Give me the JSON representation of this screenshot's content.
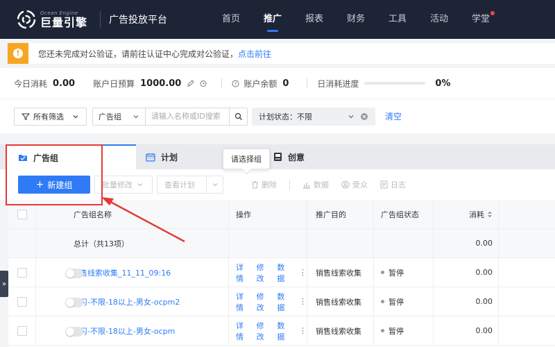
{
  "topnav": {
    "logo_en": "Ocean Engine",
    "logo_cn": "巨量引擎",
    "platform": "广告投放平台",
    "items": [
      {
        "label": "首页",
        "active": false
      },
      {
        "label": "推广",
        "active": true
      },
      {
        "label": "报表",
        "active": false
      },
      {
        "label": "财务",
        "active": false
      },
      {
        "label": "工具",
        "active": false
      },
      {
        "label": "活动",
        "active": false
      },
      {
        "label": "学堂",
        "active": false,
        "dot": true
      }
    ]
  },
  "alert": {
    "text": "您还未完成对公验证，请前往认证中心完成对公验证，",
    "link": "点击前往"
  },
  "stats": {
    "today_cost_label": "今日消耗",
    "today_cost": "0.00",
    "daily_budget_label": "账户日预算",
    "daily_budget": "1000.00",
    "balance_label": "账户余额",
    "balance": "0",
    "progress_label": "日消耗进度",
    "progress": "0%",
    "progress_value": 0
  },
  "filters": {
    "all_filter": "所有筛选",
    "search_type": "广告组",
    "search_placeholder": "请输入名称或ID搜索",
    "status_select": "计划状态：不限",
    "clear": "清空"
  },
  "tabs": [
    {
      "label": "广告组",
      "active": true
    },
    {
      "label": "计划",
      "active": false
    },
    {
      "label": "创意",
      "active": false
    }
  ],
  "tooltip": "请选择组",
  "toolbar": {
    "new_group": "新建组",
    "batch_edit": "批量修改",
    "view_plan": "查看计划",
    "delete": "删除",
    "data": "数据",
    "audience": "受众",
    "log": "日志"
  },
  "table": {
    "headers": {
      "name": "广告组名称",
      "operation": "操作",
      "goal": "推广目的",
      "status": "广告组状态",
      "cost": "消耗"
    },
    "summary_label": "总计（共13项）",
    "summary_cost": "0.00",
    "op_labels": {
      "detail": "详情",
      "edit": "修改",
      "data": "数据"
    },
    "rows": [
      {
        "name": "销售线索收集_11_11_09:16",
        "goal": "销售线索收集",
        "status": "暂停",
        "cost": "0.00"
      },
      {
        "name": "练习-不限-18以上-男女-ocpm2",
        "goal": "销售线索收集",
        "status": "暂停",
        "cost": "0.00"
      },
      {
        "name": "练习-不限-18以上-男女-ocpm",
        "goal": "销售线索收集",
        "status": "暂停",
        "cost": "0.00"
      }
    ]
  },
  "colors": {
    "primary": "#2f7bf6",
    "nav_bg": "#1c2436",
    "warning": "#f6a623",
    "annotation": "#e53935"
  }
}
